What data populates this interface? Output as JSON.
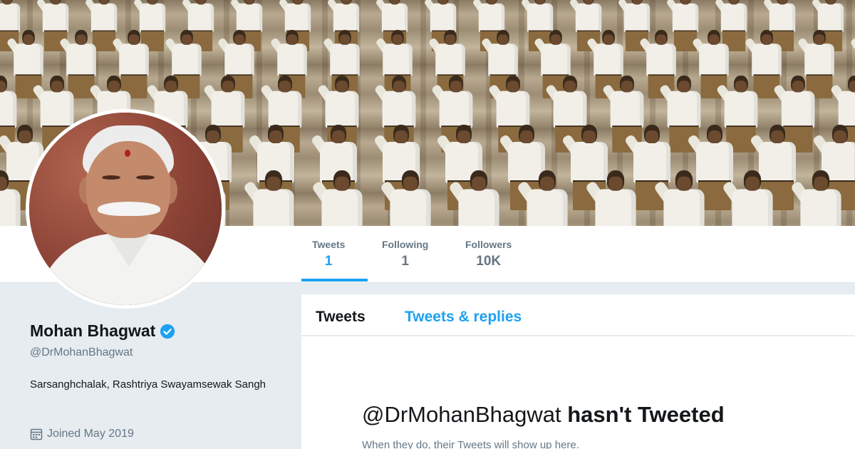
{
  "banner": {
    "description_icon": "banner-photo"
  },
  "profile": {
    "name": "Mohan Bhagwat",
    "handle": "@DrMohanBhagwat",
    "bio": "Sarsanghchalak, Rashtriya Swayamsewak Sangh",
    "joined": "Joined May 2019",
    "verified_icon": "verified-badge-icon",
    "calendar_icon": "calendar-icon"
  },
  "stats": [
    {
      "label": "Tweets",
      "value": "1"
    },
    {
      "label": "Following",
      "value": "1"
    },
    {
      "label": "Followers",
      "value": "10K"
    }
  ],
  "tabs": {
    "tweets": "Tweets",
    "tweets_replies": "Tweets & replies"
  },
  "empty_state": {
    "handle": "@DrMohanBhagwat",
    "title_rest": "hasn't Tweeted",
    "subtitle": "When they do, their Tweets will show up here."
  },
  "colors": {
    "accent": "#1da1f2",
    "text": "#14171a",
    "muted": "#657786",
    "background": "#e6ecf0"
  }
}
